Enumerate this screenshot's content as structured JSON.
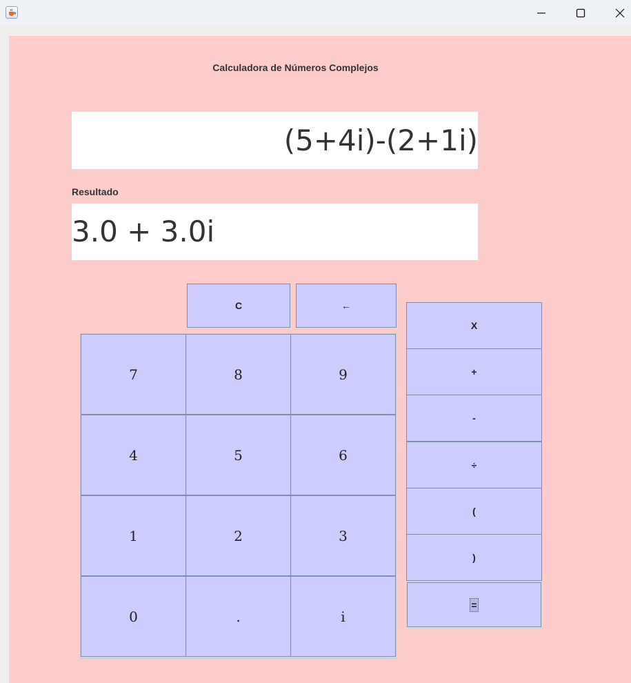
{
  "window": {
    "icon": "java-cup-icon",
    "controls": [
      "minimize-icon",
      "maximize-icon",
      "close-icon"
    ]
  },
  "app": {
    "title": "Calculadora de Números Complejos",
    "expression": "(5+4i)-(2+1i)",
    "result_label": "Resultado",
    "result": "3.0 + 3.0i"
  },
  "top_buttons": {
    "clear": "C",
    "backspace": "←"
  },
  "keypad": [
    "7",
    "8",
    "9",
    "4",
    "5",
    "6",
    "1",
    "2",
    "3",
    "0",
    ".",
    "i"
  ],
  "operators": {
    "multiply": "X",
    "add": "+",
    "subtract": "-",
    "divide": "÷",
    "open_paren": "(",
    "close_paren": ")",
    "equals": "="
  },
  "colors": {
    "panel_background": "#ffcccc",
    "button_background": "#ccccff",
    "display_background": "#ffffff"
  }
}
